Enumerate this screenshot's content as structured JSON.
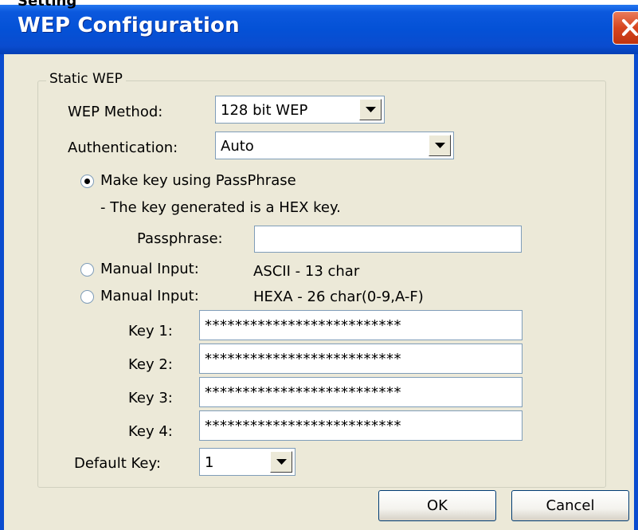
{
  "window": {
    "title": "WEP Configuration",
    "top_strip_text": "Setting"
  },
  "group": {
    "title": "Static WEP"
  },
  "wep_method": {
    "label": "WEP Method:",
    "value": "128 bit WEP"
  },
  "authentication": {
    "label": "Authentication:",
    "value": "Auto"
  },
  "passphrase_option": {
    "label": "Make key using PassPhrase",
    "note": "- The key generated is a HEX key.",
    "selected": true
  },
  "passphrase": {
    "label": "Passphrase:",
    "value": ""
  },
  "manual_ascii": {
    "label": "Manual Input:",
    "hint": "ASCII - 13 char",
    "selected": false
  },
  "manual_hex": {
    "label": "Manual Input:",
    "hint": "HEXA - 26 char(0-9,A-F)",
    "selected": false
  },
  "keys": [
    {
      "label": "Key 1:",
      "value": "**************************"
    },
    {
      "label": "Key 2:",
      "value": "**************************"
    },
    {
      "label": "Key 3:",
      "value": "**************************"
    },
    {
      "label": "Key 4:",
      "value": "**************************"
    }
  ],
  "default_key": {
    "label": "Default Key:",
    "value": "1"
  },
  "buttons": {
    "ok": "OK",
    "cancel": "Cancel"
  },
  "icons": {
    "close": "close-icon",
    "dropdown": "chevron-down-icon"
  },
  "colors": {
    "titlebar": "#0451d6",
    "close_button": "#d6451f",
    "dialog_bg": "#ece9d8"
  }
}
